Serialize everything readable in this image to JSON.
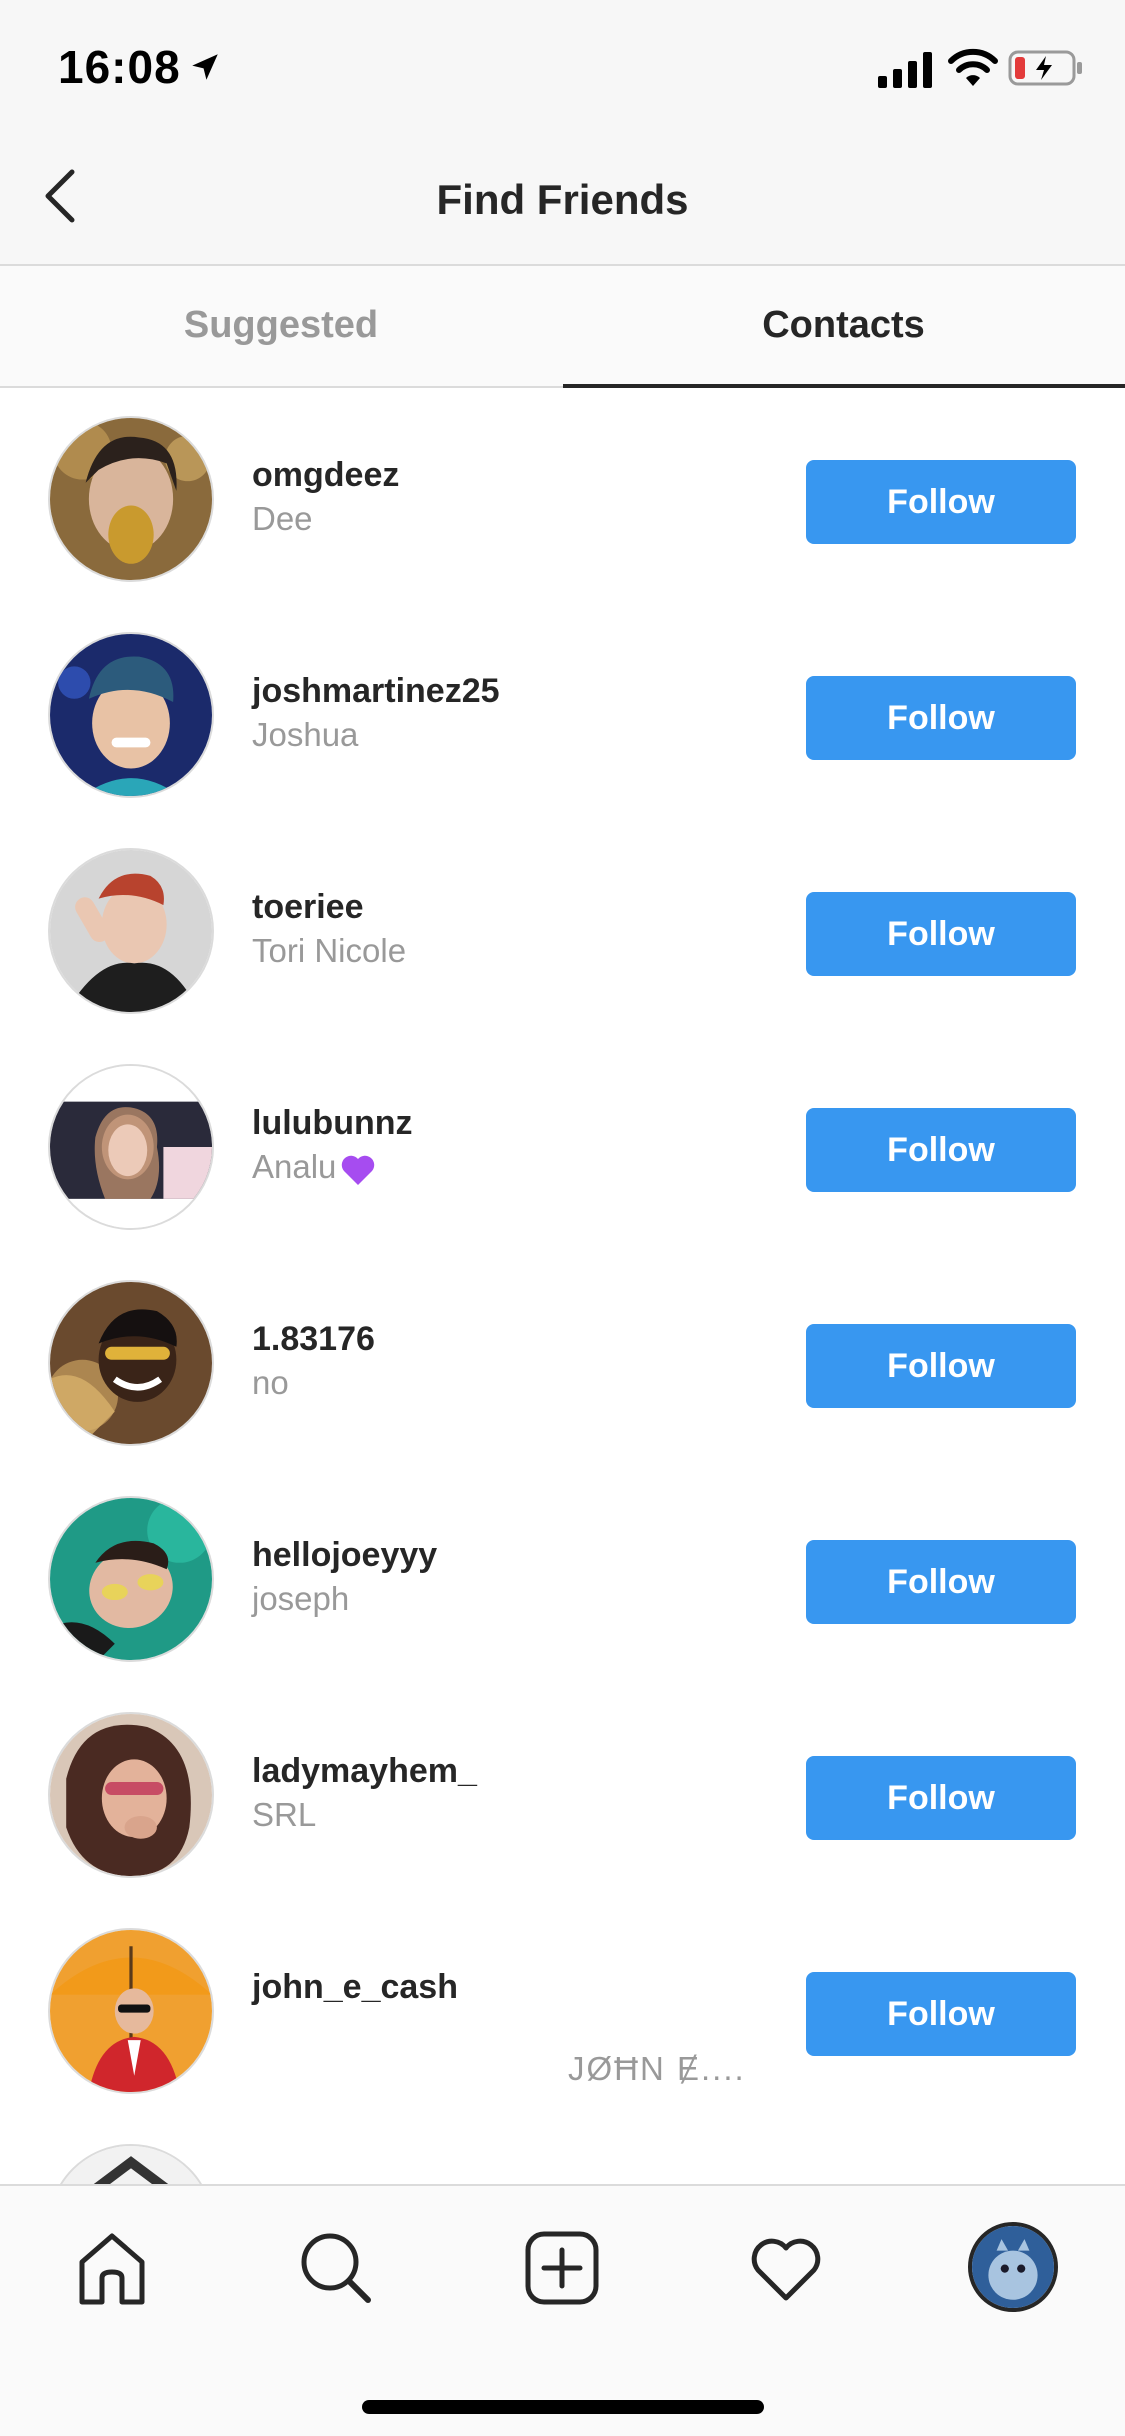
{
  "status_bar": {
    "time": "16:08"
  },
  "header": {
    "title": "Find Friends"
  },
  "tabs": [
    {
      "label": "Suggested",
      "active": false
    },
    {
      "label": "Contacts",
      "active": true
    }
  ],
  "contacts": [
    {
      "username": "omgdeez",
      "name": "Dee",
      "button": "Follow"
    },
    {
      "username": "joshmartinez25",
      "name": "Joshua",
      "button": "Follow"
    },
    {
      "username": "toeriee",
      "name": "Tori Nicole",
      "button": "Follow"
    },
    {
      "username": "lulubunnz",
      "name": "Analu",
      "emoji": "purple-heart",
      "button": "Follow"
    },
    {
      "username": "1.83176",
      "name": "no",
      "button": "Follow"
    },
    {
      "username": "hellojoeyyy",
      "name": "joseph",
      "button": "Follow"
    },
    {
      "username": "ladymayhem_",
      "name": "SRL",
      "button": "Follow"
    },
    {
      "username": "john_e_cash",
      "name": "JØĦN Ɇ....",
      "button": "Follow"
    }
  ],
  "colors": {
    "accent": "#3897f0",
    "text_primary": "#262626",
    "text_secondary": "#999999",
    "divider": "#dbdbdb"
  },
  "icons": {
    "status": [
      "location-arrow-icon",
      "signal-icon",
      "wifi-icon",
      "battery-icon"
    ],
    "bottom_nav": [
      "home-icon",
      "search-icon",
      "add-post-icon",
      "activity-heart-icon",
      "profile-avatar"
    ]
  }
}
